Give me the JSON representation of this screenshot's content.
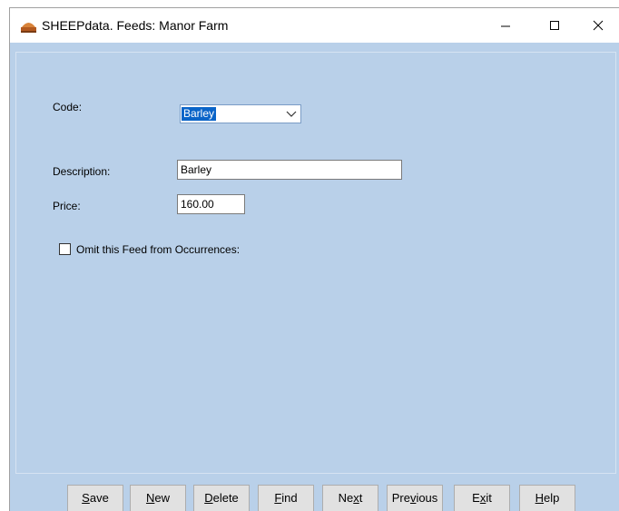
{
  "window": {
    "title": "SHEEPdata. Feeds: Manor Farm",
    "controls": {
      "minimize": "—",
      "maximize": "☐",
      "close": "✕"
    }
  },
  "form": {
    "code_label": "Code:",
    "code_value": "Barley",
    "description_label": "Description:",
    "description_value": "Barley",
    "price_label": "Price:",
    "price_value": "160.00",
    "omit_label": "Omit this Feed from Occurrences:",
    "omit_checked": false
  },
  "buttons": [
    {
      "pre": "",
      "key": "S",
      "post": "ave"
    },
    {
      "pre": "",
      "key": "N",
      "post": "ew"
    },
    {
      "pre": "",
      "key": "D",
      "post": "elete"
    },
    {
      "pre": "",
      "key": "F",
      "post": "ind"
    },
    {
      "pre": "Ne",
      "key": "x",
      "post": "t"
    },
    {
      "pre": "Pre",
      "key": "v",
      "post": "ious"
    },
    {
      "pre": "E",
      "key": "x",
      "post": "it"
    },
    {
      "pre": "",
      "key": "H",
      "post": "elp"
    }
  ],
  "colors": {
    "client_background": "#b9d0e9",
    "selection": "#0a64c8",
    "button_face": "#e1e1e1"
  }
}
